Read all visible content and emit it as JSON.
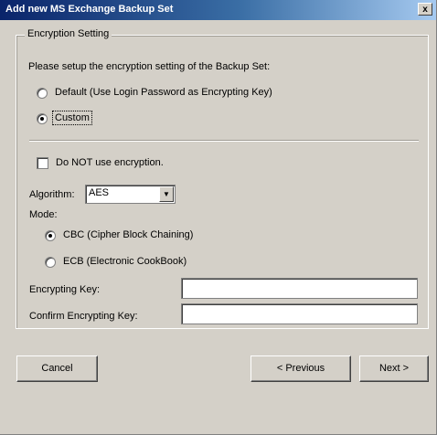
{
  "window": {
    "title": "Add new MS Exchange Backup Set",
    "close_label": "x"
  },
  "encryption": {
    "group_label": "Encryption Setting",
    "instruction": "Please setup the encryption setting of the Backup Set:",
    "options": [
      {
        "label": "Default (Use Login Password as Encrypting Key)",
        "checked": false
      },
      {
        "label": "Custom",
        "checked": true
      }
    ],
    "no_encryption_label": "Do NOT use encryption.",
    "no_encryption_checked": false,
    "algorithm_label": "Algorithm:",
    "algorithm_value": "AES",
    "mode_label": "Mode:",
    "modes": [
      {
        "label": "CBC (Cipher Block Chaining)",
        "checked": true
      },
      {
        "label": "ECB (Electronic CookBook)",
        "checked": false
      }
    ],
    "key_label": "Encrypting Key:",
    "key_value": "",
    "confirm_key_label": "Confirm Encrypting Key:",
    "confirm_key_value": ""
  },
  "buttons": {
    "cancel": "Cancel",
    "previous": "< Previous",
    "next": "Next >"
  }
}
